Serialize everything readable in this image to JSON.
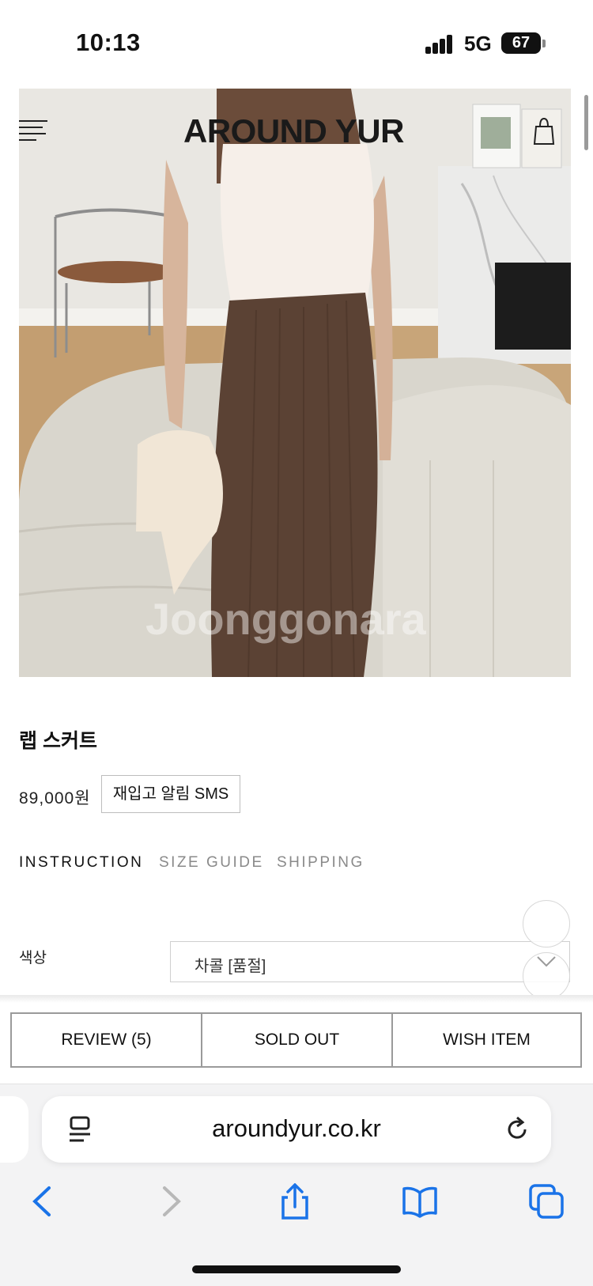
{
  "status_bar": {
    "time": "10:13",
    "network": "5G",
    "battery": "67",
    "icons": [
      "signal-bars-icon",
      "battery-icon"
    ]
  },
  "header": {
    "brand": "AROUND YUR",
    "icons": [
      "menu-icon",
      "shopping-bag-icon"
    ]
  },
  "product": {
    "title": "랩 스커트",
    "price": "89,000원",
    "restock_button": "재입고 알림 SMS"
  },
  "info_tabs": [
    {
      "label": "INSTRUCTION",
      "active": true
    },
    {
      "label": "SIZE GUIDE",
      "active": false
    },
    {
      "label": "SHIPPING",
      "active": false
    }
  ],
  "option": {
    "label": "색상",
    "selected": "차콜 [품절]"
  },
  "action_bar": {
    "review": "REVIEW (5)",
    "sold_out": "SOLD OUT",
    "wish": "WISH ITEM"
  },
  "browser": {
    "address": "aroundyur.co.kr",
    "icons": [
      "reader-icon",
      "reload-icon",
      "back-icon",
      "forward-icon",
      "share-icon",
      "bookmarks-icon",
      "tabs-icon"
    ]
  },
  "colors": {
    "skirt_brown": "#5b4234",
    "sofa": "#dedbd3",
    "floor": "#c9a57a",
    "ios_blue": "#1a73e8"
  }
}
